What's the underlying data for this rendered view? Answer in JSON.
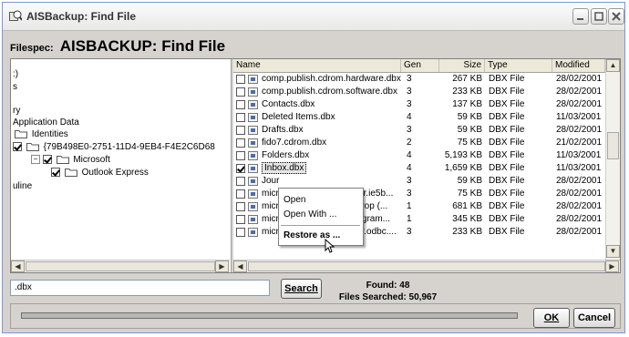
{
  "window": {
    "title": "AISBackup: Find File"
  },
  "filespec": {
    "label": "Filespec:",
    "value": "AISBACKUP: Find File"
  },
  "tree": {
    "rows": [
      {
        "text": ":)"
      },
      {
        "text": "s"
      },
      {
        "text": "ry"
      },
      {
        "text": "Application Data"
      },
      {
        "text": "Identities"
      },
      {
        "text": "{79B498E0-2751-11D4-9EB4-F4E2C6D68"
      },
      {
        "text": "Microsoft"
      },
      {
        "text": "Outlook Express"
      },
      {
        "text": "uline"
      }
    ]
  },
  "list": {
    "columns": {
      "name": "Name",
      "gen": "Gen",
      "size": "Size",
      "type": "Type",
      "modified": "Modified"
    },
    "rows": [
      {
        "name": "comp.publish.cdrom.hardware.dbx",
        "gen": "3",
        "size": "267 KB",
        "type": "DBX File",
        "modified": "28/02/2001",
        "checked": false
      },
      {
        "name": "comp.publish.cdrom.software.dbx",
        "gen": "3",
        "size": "233 KB",
        "type": "DBX File",
        "modified": "28/02/2001",
        "checked": false
      },
      {
        "name": "Contacts.dbx",
        "gen": "3",
        "size": "137 KB",
        "type": "DBX File",
        "modified": "28/02/2001",
        "checked": false
      },
      {
        "name": "Deleted Items.dbx",
        "gen": "4",
        "size": "59 KB",
        "type": "DBX File",
        "modified": "11/03/2001",
        "checked": false
      },
      {
        "name": "Drafts.dbx",
        "gen": "3",
        "size": "59 KB",
        "type": "DBX File",
        "modified": "28/02/2001",
        "checked": false
      },
      {
        "name": "fido7.cdrom.dbx",
        "gen": "2",
        "size": "75 KB",
        "type": "DBX File",
        "modified": "21/02/2001",
        "checked": false
      },
      {
        "name": "Folders.dbx",
        "gen": "4",
        "size": "5,193 KB",
        "type": "DBX File",
        "modified": "11/03/2001",
        "checked": false
      },
      {
        "name": "Inbox.dbx",
        "gen": "4",
        "size": "1,659 KB",
        "type": "DBX File",
        "modified": "11/03/2001",
        "checked": true
      },
      {
        "name": "Jour",
        "gen": "3",
        "size": "59 KB",
        "type": "DBX File",
        "modified": "28/02/2001",
        "checked": false
      },
      {
        "name": "micr",
        "name_tail": "ver.ie5b...",
        "gen": "3",
        "size": "75 KB",
        "type": "DBX File",
        "modified": "28/02/2001",
        "checked": false
      },
      {
        "name": "micr",
        "name_tail": "terop (...",
        "gen": "1",
        "size": "681 KB",
        "type": "DBX File",
        "modified": "28/02/2001",
        "checked": false
      },
      {
        "name": "micr",
        "name_tail": "rogram...",
        "gen": "1",
        "size": "345 KB",
        "type": "DBX File",
        "modified": "28/02/2001",
        "checked": false
      },
      {
        "name": "microsoft.public.sqlserver.odbc....",
        "gen": "3",
        "size": "233 KB",
        "type": "DBX File",
        "modified": "28/02/2001",
        "checked": false
      }
    ]
  },
  "context_menu": {
    "items": [
      {
        "label": "Open"
      },
      {
        "label": "Open With ..."
      },
      {
        "label": "Restore as ..."
      }
    ]
  },
  "search": {
    "value": ".dbx",
    "button": "Search"
  },
  "stats": {
    "found": "Found: 48",
    "searched": "Files Searched: 50,967"
  },
  "buttons": {
    "ok": "OK",
    "cancel": "Cancel"
  },
  "progress": {
    "fraction": 1.0
  },
  "colors": {
    "selection_border": "#000000",
    "folder": "#f3d36b",
    "progress": "#b7b7b7"
  }
}
